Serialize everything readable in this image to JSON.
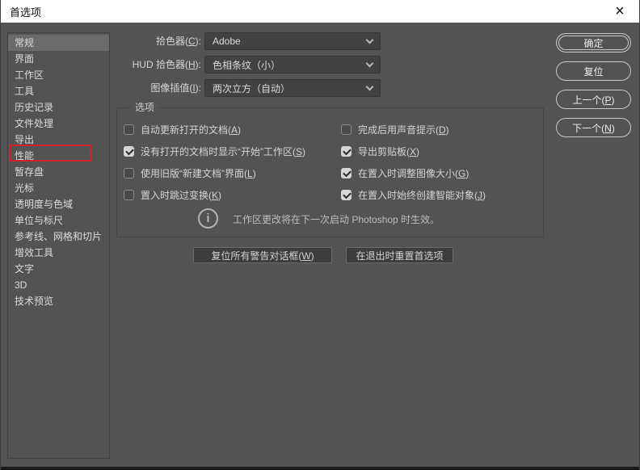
{
  "window": {
    "title": "首选项",
    "close_glyph": "×"
  },
  "colors": {
    "titlebar_bg": "#ffffff",
    "dialog_bg": "#535353",
    "annotation_red": "#d2232c",
    "input_bg": "#424242",
    "selected_item_bg": "#6b6b6b"
  },
  "sidebar": {
    "selected": "常规",
    "annotated": "性能",
    "items": [
      "常规",
      "界面",
      "工作区",
      "工具",
      "历史记录",
      "文件处理",
      "导出",
      "性能",
      "暂存盘",
      "光标",
      "透明度与色域",
      "单位与标尺",
      "参考线、网格和切片",
      "增效工具",
      "文字",
      "3D",
      "技术预览"
    ]
  },
  "pickers": [
    {
      "label_pre": "拾色器(",
      "key": "C",
      "label_post": "):",
      "value": "Adobe"
    },
    {
      "label_pre": "HUD 拾色器(",
      "key": "H",
      "label_post": "):",
      "value": "色相条纹（小）"
    },
    {
      "label_pre": "图像插值(",
      "key": "I",
      "label_post": "):",
      "value": "两次立方（自动）"
    }
  ],
  "options": {
    "group_label": "选项",
    "left": [
      {
        "checked": false,
        "pre": "自动更新打开的文档(",
        "key": "A",
        "post": ")"
      },
      {
        "checked": true,
        "pre": "没有打开的文档时显示“开始”工作区(",
        "key": "S",
        "post": ")"
      },
      {
        "checked": false,
        "pre": "使用旧版“新建文档”界面(",
        "key": "L",
        "post": ")"
      },
      {
        "checked": false,
        "pre": "置入时跳过变换(",
        "key": "K",
        "post": ")"
      }
    ],
    "right": [
      {
        "checked": false,
        "pre": "完成后用声音提示(",
        "key": "D",
        "post": ")"
      },
      {
        "checked": true,
        "pre": "导出剪贴板(",
        "key": "X",
        "post": ")"
      },
      {
        "checked": true,
        "pre": "在置入时调整图像大小(",
        "key": "G",
        "post": ")"
      },
      {
        "checked": true,
        "pre": "在置入时始终创建智能对象(",
        "key": "J",
        "post": ")"
      }
    ],
    "note": "工作区更改将在下一次启动 Photoshop 时生效。"
  },
  "footer_buttons": [
    {
      "pre": "复位所有警告对话框(",
      "key": "W",
      "post": ")"
    },
    {
      "pre": "在退出时重置首选项",
      "key": "",
      "post": ""
    }
  ],
  "action_buttons": [
    {
      "pre": "确定",
      "key": "",
      "post": ""
    },
    {
      "pre": "复位",
      "key": "",
      "post": ""
    },
    {
      "pre": "上一个(",
      "key": "P",
      "post": ")"
    },
    {
      "pre": "下一个(",
      "key": "N",
      "post": ")"
    }
  ]
}
